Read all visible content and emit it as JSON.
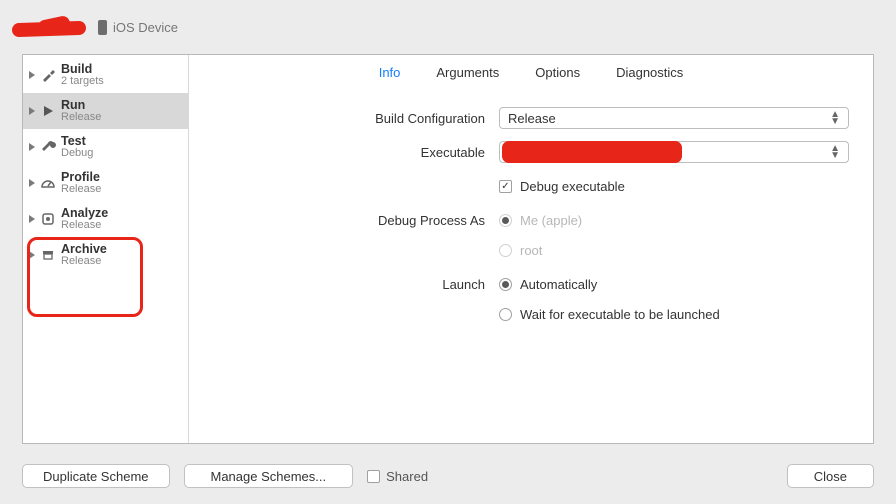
{
  "header": {
    "device": "iOS Device"
  },
  "sidebar": {
    "items": [
      {
        "title": "Build",
        "sub": "2 targets"
      },
      {
        "title": "Run",
        "sub": "Release"
      },
      {
        "title": "Test",
        "sub": "Debug"
      },
      {
        "title": "Profile",
        "sub": "Release"
      },
      {
        "title": "Analyze",
        "sub": "Release"
      },
      {
        "title": "Archive",
        "sub": "Release"
      }
    ]
  },
  "tabs": {
    "info": "Info",
    "arguments": "Arguments",
    "options": "Options",
    "diagnostics": "Diagnostics"
  },
  "form": {
    "buildConfig": {
      "label": "Build Configuration",
      "value": "Release"
    },
    "executable": {
      "label": "Executable"
    },
    "debugExec": {
      "label": "Debug executable"
    },
    "debugAs": {
      "label": "Debug Process As",
      "me": "Me (apple)",
      "root": "root"
    },
    "launch": {
      "label": "Launch",
      "auto": "Automatically",
      "wait": "Wait for executable to be launched"
    }
  },
  "footer": {
    "duplicate": "Duplicate Scheme",
    "manage": "Manage Schemes...",
    "shared": "Shared",
    "close": "Close"
  }
}
